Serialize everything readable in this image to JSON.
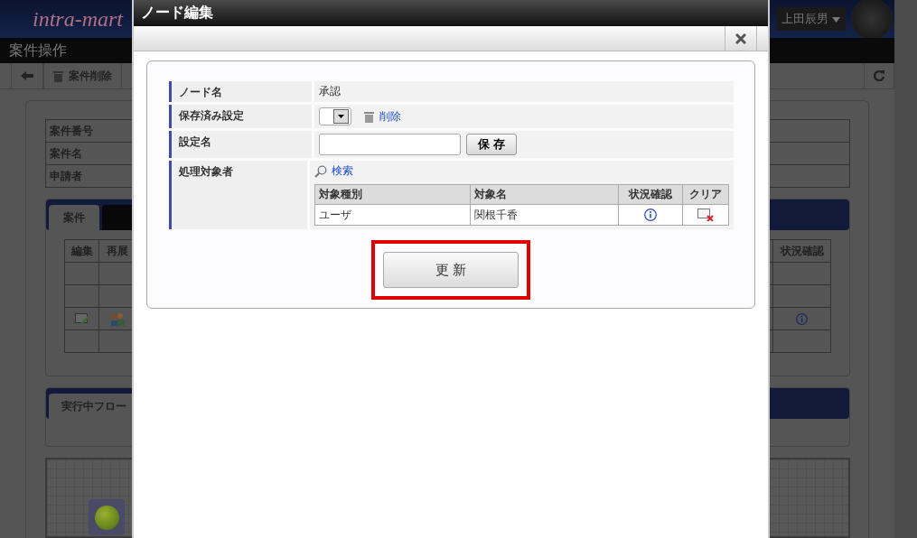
{
  "app": {
    "logo": "intra-mart",
    "user": "上田辰男",
    "page_title": "案件操作",
    "toolbar": {
      "delete_label": "案件削除"
    }
  },
  "case_info": {
    "rows": [
      {
        "label": "案件番号"
      },
      {
        "label": "案件名"
      },
      {
        "label": "申請者"
      }
    ]
  },
  "case_tabs": [
    {
      "label": "案件",
      "selected": true
    }
  ],
  "case_table": {
    "columns": [
      "編集",
      "再展",
      "状況確認"
    ],
    "rows": [
      {
        "icons": false
      },
      {
        "icons": false
      },
      {
        "icons": true
      },
      {
        "icons": false
      }
    ]
  },
  "flow_panel": {
    "tab": "実行中フロー"
  },
  "dialog": {
    "title": "ノード編集",
    "fields": [
      {
        "kind": "text",
        "label": "ノード名",
        "value": "承認"
      },
      {
        "kind": "saved",
        "label": "保存済み設定",
        "delete_link": "削除"
      },
      {
        "kind": "name",
        "label": "設定名",
        "button": "保 存"
      },
      {
        "kind": "targets",
        "label": "処理対象者",
        "search_link": "検索",
        "columns": [
          "対象種別",
          "対象名",
          "状況確認",
          "クリア"
        ],
        "rows": [
          {
            "type": "ユーザ",
            "name": "関根千香"
          }
        ]
      }
    ],
    "update_button": "更 新",
    "highlighted": true
  }
}
